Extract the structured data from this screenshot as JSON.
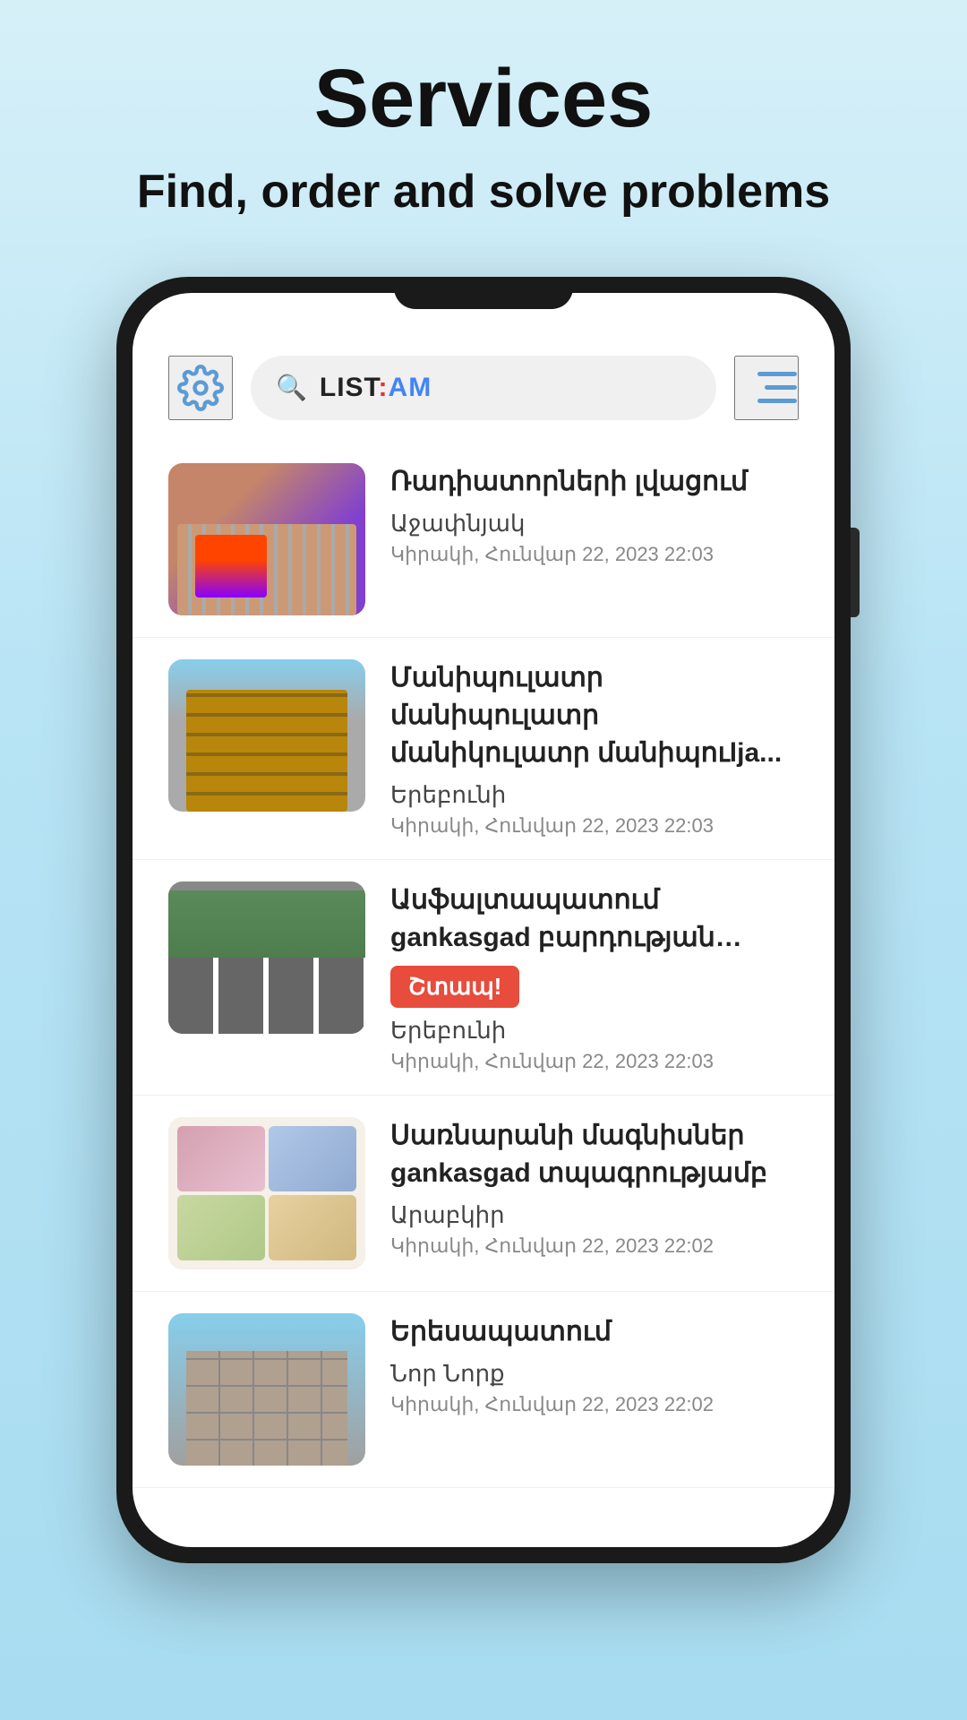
{
  "header": {
    "title": "Services",
    "subtitle": "Find, order and solve problems"
  },
  "app": {
    "search_placeholder": "List:am",
    "search_logo": "LIST:AM"
  },
  "listings": [
    {
      "id": 1,
      "title": "Ռադիատորների լվացում",
      "location": "Աջափնյակ",
      "date": "Կիրակի, Հունվար 22, 2023 22:03",
      "thumb_type": "radiators",
      "urgent": false
    },
    {
      "id": 2,
      "title": "Մանիպուլատր մանիպուլատր մանիկուլատր մանիպուlja...",
      "location": "Երեբունի",
      "date": "Կիրակի, Հունվար 22, 2023 22:03",
      "thumb_type": "manipulator",
      "urgent": false
    },
    {
      "id": 3,
      "title": "Ասֆալտապատում gankasgad բարդության աzhiatank asphalt",
      "title_display": "Ասֆալտապատում․ gankasgad բարդության ażhiatanę asphalt",
      "location": "Երեբունի",
      "date": "Կիրակի, Հունվար 22, 2023 22:03",
      "thumb_type": "asphalt",
      "urgent": true,
      "urgent_label": "Շտապ!"
    },
    {
      "id": 4,
      "title": "Սառնարանի մագնիսներ gankasgad տպագրությամբ",
      "location": "Արաբկիր",
      "date": "Կիրակի, Հունվար 22, 2023 22:02",
      "thumb_type": "photos",
      "urgent": false
    },
    {
      "id": 5,
      "title": "Երեսապատում",
      "subtitle2": "Նոր Նորք",
      "location": "Նոր Նorq",
      "date": "Կիրակի, Հունվար 22, 2023 22:02",
      "thumb_type": "building",
      "urgent": false
    }
  ]
}
